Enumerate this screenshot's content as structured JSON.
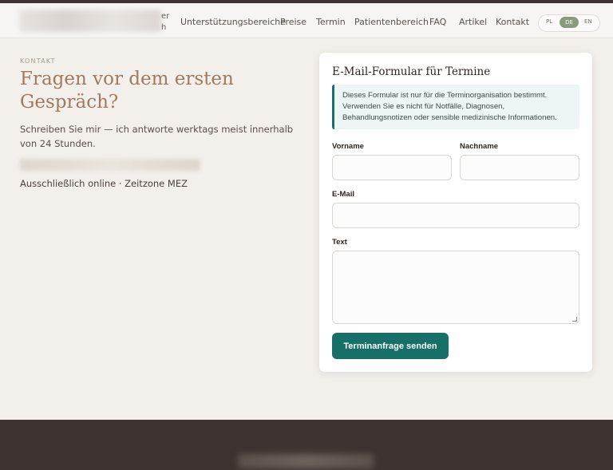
{
  "nav": {
    "logo_cut_lines": [
      "er",
      "h"
    ],
    "items": [
      "Unterstützungsbereiche",
      "Preise",
      "Termin",
      "Patientenbereich",
      "FAQ",
      "Artikel",
      "Kontakt"
    ],
    "languages": [
      "PL",
      "DE",
      "EN"
    ],
    "active_language": "DE"
  },
  "intro": {
    "eyebrow": "KONTAKT",
    "heading": "Fragen vor dem ersten Gespräch?",
    "lead": "Schreiben Sie mir — ich antworte werktags meist innerhalb von 24 Stunden.",
    "availability": "Ausschließlich online · Zeitzone MEZ"
  },
  "form": {
    "title": "E-Mail-Formular für Termine",
    "notice": "Dieses Formular ist nur für die Terminorganisation bestimmt. Verwenden Sie es nicht für Notfälle, Diagnosen, Behandlungsnotizen oder sensible medizinische Informationen.",
    "labels": {
      "first_name": "Vorname",
      "last_name": "Nachname",
      "email": "E-Mail",
      "text": "Text"
    },
    "values": {
      "first_name": "",
      "last_name": "",
      "email": "",
      "text": ""
    },
    "submit_label": "Terminanfrage senden"
  },
  "colors": {
    "accent": "#167067",
    "heading": "#a07a5e",
    "footer": "#3d3330",
    "background": "#f3efeb"
  }
}
